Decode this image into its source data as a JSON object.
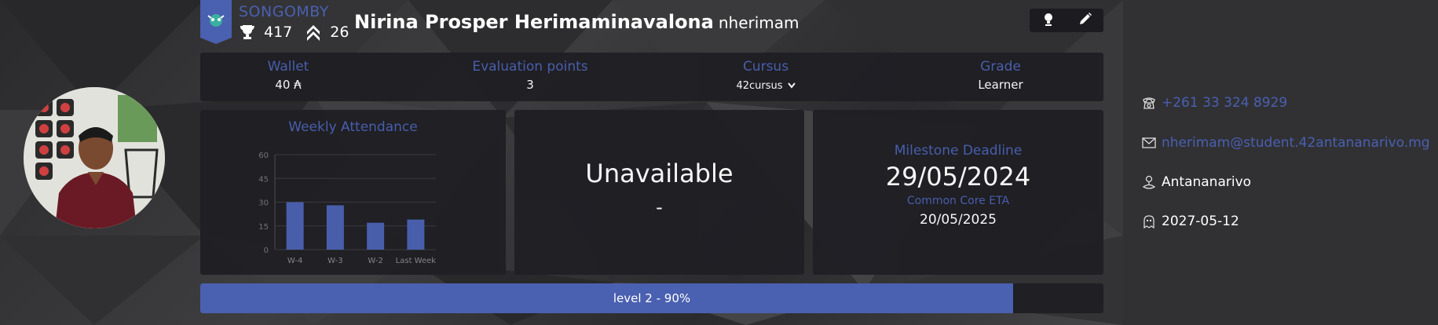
{
  "coalition": {
    "name": "SONGOMBY",
    "accent": "#4a60b0"
  },
  "user": {
    "full_name": "Nirina Prosper Herimaminavalona",
    "login": "nherimam",
    "trophies": "417",
    "rank_points": "26"
  },
  "toolbar": {
    "icons": [
      "bulb-icon",
      "pencil-icon"
    ]
  },
  "info": {
    "wallet_label": "Wallet",
    "wallet_value": "40 ₳",
    "eval_label": "Evaluation points",
    "eval_value": "3",
    "cursus_label": "Cursus",
    "cursus_value": "42cursus",
    "grade_label": "Grade",
    "grade_value": "Learner"
  },
  "attendance": {
    "title": "Weekly Attendance",
    "chart_data": {
      "type": "bar",
      "categories": [
        "W-4",
        "W-3",
        "W-2",
        "Last Week"
      ],
      "values": [
        30,
        28,
        17,
        19
      ],
      "ylim": [
        0,
        60
      ],
      "yticks": [
        "0",
        "15",
        "30",
        "45",
        "60"
      ],
      "grid": true,
      "bar_color": "#4a60b0"
    }
  },
  "unavailable": {
    "title": "Unavailable",
    "value": "-"
  },
  "milestone": {
    "label": "Milestone Deadline",
    "date": "29/05/2024",
    "eta_label": "Common Core ETA",
    "eta_date": "20/05/2025"
  },
  "level": {
    "text": "level 2 - 90%",
    "progress": 0.9
  },
  "contacts": {
    "phone": "+261 33 324 8929",
    "email": "nherimam@student.42antananarivo.mg",
    "location": "Antananarivo",
    "date": "2027-05-12"
  }
}
